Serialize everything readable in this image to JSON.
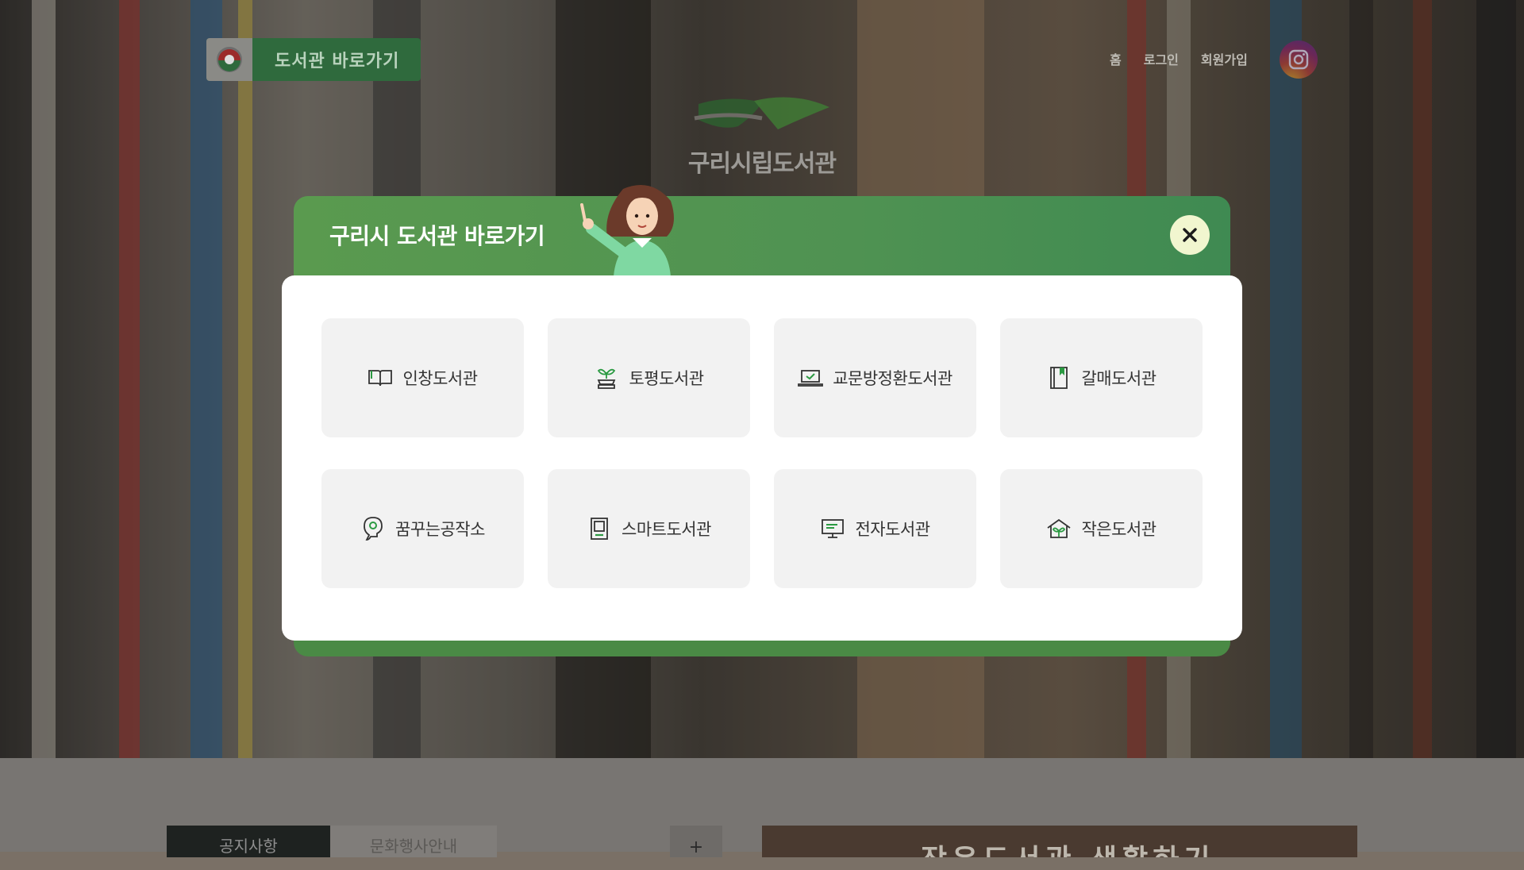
{
  "header": {
    "quick_link_label": "도서관 바로가기",
    "nav": [
      "홈",
      "로그인",
      "회원가입"
    ],
    "site_logo_text": "구리시립도서관",
    "instagram_icon": "instagram-icon"
  },
  "modal": {
    "title": "구리시 도서관 바로가기",
    "close_icon": "close-icon",
    "colors": {
      "header_green": "#4a8a45",
      "close_bg": "#f1f6cf",
      "card_bg": "#f2f2f2"
    },
    "libraries": [
      {
        "label": "인창도서관",
        "icon": "open-book-icon"
      },
      {
        "label": "토평도서관",
        "icon": "sprout-book-icon"
      },
      {
        "label": "교문방정환도서관",
        "icon": "laptop-check-icon"
      },
      {
        "label": "갈매도서관",
        "icon": "bookmark-book-icon"
      },
      {
        "label": "꿈꾸는공작소",
        "icon": "lightbulb-head-icon"
      },
      {
        "label": "스마트도서관",
        "icon": "kiosk-icon"
      },
      {
        "label": "전자도서관",
        "icon": "monitor-icon"
      },
      {
        "label": "작은도서관",
        "icon": "house-sprout-icon"
      }
    ]
  },
  "lower": {
    "tabs": [
      "공지사항",
      "문화행사안내"
    ],
    "more_label": "+",
    "banner_text": "작은도서관 생활하기"
  }
}
